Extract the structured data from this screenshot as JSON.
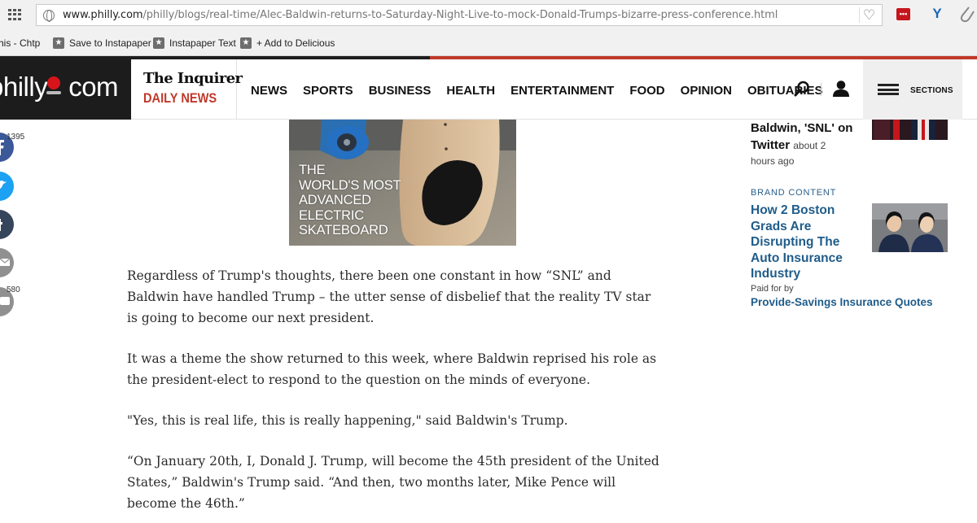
{
  "browser": {
    "url_domain": "www.philly.com",
    "url_path": "/philly/blogs/real-time/Alec-Baldwin-returns-to-Saturday-Night-Live-to-mock-Donald-Trumps-bizarre-press-conference.html",
    "extension_red_label": "•••",
    "extension_y_label": "Y"
  },
  "bookmarks": [
    {
      "label": "his - Chtp"
    },
    {
      "label": "Save to Instapaper"
    },
    {
      "label": "Instapaper Text"
    },
    {
      "label": "+ Add to Delicious"
    }
  ],
  "site": {
    "logo_text": "philly com",
    "inquirer_name": "The Inquirer",
    "daily_news": "DAILY NEWS",
    "nav": [
      "NEWS",
      "SPORTS",
      "BUSINESS",
      "HEALTH",
      "ENTERTAINMENT",
      "FOOD",
      "OPINION",
      "OBITUARIES"
    ],
    "sections_label": "SECTIONS"
  },
  "share": {
    "facebook_count": "1395",
    "comments_count": "580"
  },
  "ad": {
    "lines": [
      "THE",
      "WORLD'S MOST",
      "ADVANCED",
      "ELECTRIC",
      "SKATEBOARD"
    ]
  },
  "article": {
    "paragraphs": [
      "Regardless of Trump's thoughts, there been one constant in how “SNL” and Baldwin have handled Trump – the utter sense of disbelief that the reality TV star is going to become our next president.",
      "It was a theme the show returned to this week, where Baldwin reprised his role as the president-elect to respond to the question on the minds of everyone.",
      "\"Yes, this is real life, this is really happening,\" said Baldwin's Trump.",
      "“On January 20th, I, Donald J. Trump, will become the 45th president of the United States,” Baldwin's Trump said. “And then, two months later, Mike Pence will become the 46th.”"
    ]
  },
  "rail": {
    "top_headline": "Baldwin, 'SNL' on Twitter",
    "top_time_inline": "about 2",
    "top_time_line2": "hours ago",
    "brand_label": "BRAND CONTENT",
    "brand_title": "How 2 Boston Grads Are Disrupting The Auto Insurance Industry",
    "paid_label": "Paid for by",
    "sponsor": "Provide-Savings Insurance Quotes"
  },
  "colors": {
    "brand_red": "#c0392b",
    "link_blue": "#1f5c8a",
    "facebook": "#3b5998",
    "twitter": "#1da1f2",
    "tumblr": "#35465c"
  }
}
